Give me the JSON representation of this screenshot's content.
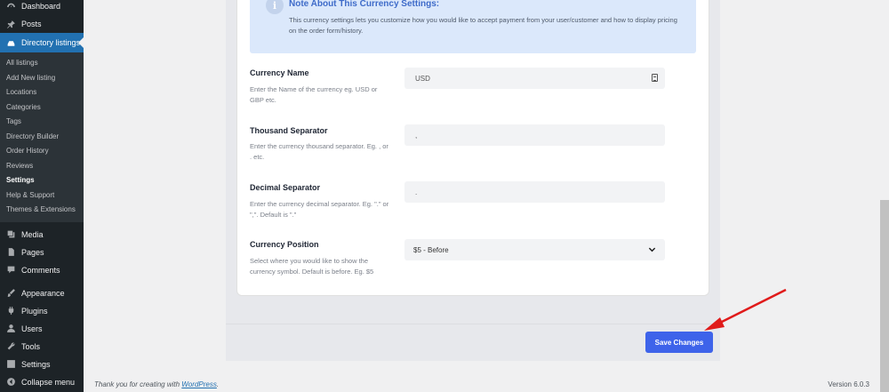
{
  "sidebar": {
    "dashboard": "Dashboard",
    "posts": "Posts",
    "directory": "Directory listings",
    "submenu": [
      "All listings",
      "Add New listing",
      "Locations",
      "Categories",
      "Tags",
      "Directory Builder",
      "Order History",
      "Reviews",
      "Settings",
      "Help & Support",
      "Themes & Extensions"
    ],
    "current_sub": "Settings",
    "media": "Media",
    "pages": "Pages",
    "comments": "Comments",
    "appearance": "Appearance",
    "plugins": "Plugins",
    "users": "Users",
    "tools": "Tools",
    "settings": "Settings",
    "collapse": "Collapse menu",
    "icons": {
      "dashboard": "dashboard-icon",
      "posts": "pin-icon",
      "directory": "directory-icon",
      "media": "media-icon",
      "pages": "pages-icon",
      "comments": "comments-icon",
      "appearance": "paintbrush-icon",
      "plugins": "plugin-icon",
      "users": "users-icon",
      "tools": "wrench-icon",
      "settings": "settings-icon",
      "collapse": "collapse-icon"
    }
  },
  "notice": {
    "title": "Note About This Currency Settings:",
    "text": "This currency settings lets you customize how you would like to accept payment from your user/customer and how to display pricing on the order form/history."
  },
  "fields": {
    "currency_name": {
      "label": "Currency Name",
      "desc": "Enter the Name of the currency eg. USD or GBP etc.",
      "value": "USD"
    },
    "thousand_sep": {
      "label": "Thousand Separator",
      "desc": "Enter the currency thousand separator. Eg. , or . etc.",
      "value": ","
    },
    "decimal_sep": {
      "label": "Decimal Separator",
      "desc": "Enter the currency decimal separator. Eg. \".\" or \",\". Default is \".\"",
      "value": "."
    },
    "currency_pos": {
      "label": "Currency Position",
      "desc": "Select where you would like to show the currency symbol. Default is before. Eg. $5",
      "value": "$5 - Before"
    }
  },
  "save_label": "Save Changes",
  "footer": {
    "thanks_prefix": "Thank you for creating with ",
    "wp_link": "WordPress",
    "thanks_suffix": ".",
    "version": "Version 6.0.3"
  },
  "colors": {
    "sidebar_bg": "#1d2327",
    "active": "#2271b1",
    "save_button": "#3e63ea",
    "notice_bg": "#dbe8fb",
    "arrow": "#e01b1b"
  }
}
